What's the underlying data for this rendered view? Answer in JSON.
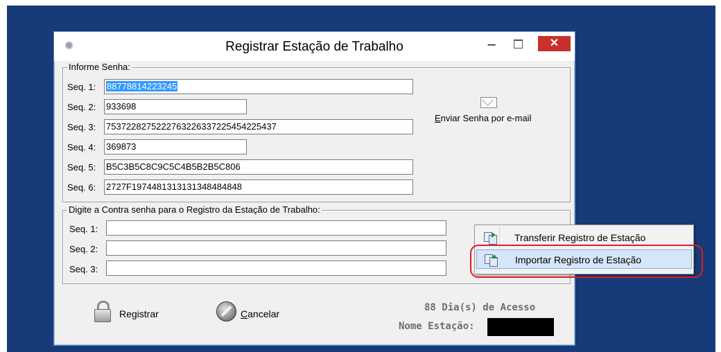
{
  "window": {
    "title": "Registrar Estação de Trabalho",
    "minimize_glyph": "–",
    "close_glyph": "✕"
  },
  "group_password": {
    "legend": "Informe Senha:",
    "rows": [
      {
        "label": "Seq. 1:",
        "value": "88778814223245"
      },
      {
        "label": "Seq. 2:",
        "value": "933698"
      },
      {
        "label": "Seq. 3:",
        "value": "753722827522276322633722545422543​7"
      },
      {
        "label": "Seq. 4:",
        "value": "369873"
      },
      {
        "label": "Seq. 5:",
        "value": "B5C3B5C8C9C5C4B5B2B5C806"
      },
      {
        "label": "Seq. 6:",
        "value": "2727F19744813131313484848​48"
      }
    ],
    "send_email": {
      "prefix": "E",
      "rest": "nviar Senha por e-mail"
    }
  },
  "group_counter": {
    "legend": "Digite a Contra senha para o Registro da Estação de Trabalho:",
    "rows": [
      {
        "label": "Seq. 1:",
        "value": ""
      },
      {
        "label": "Seq. 2:",
        "value": ""
      },
      {
        "label": "Seq. 3:",
        "value": ""
      }
    ]
  },
  "context_menu": {
    "items": [
      {
        "label": "Transferir Registro de Estação",
        "icon": "transfer-icon"
      },
      {
        "label": "Importar Registro de Estação",
        "icon": "import-icon"
      }
    ]
  },
  "footer": {
    "register_label": "Registrar",
    "cancel_prefix": "C",
    "cancel_rest": "ancelar",
    "access_days": "88 Dia(s) de Acesso",
    "station_label": "Nome Estação:"
  },
  "colors": {
    "desktop": "#163b78",
    "selection": "#3399ff",
    "close_button": "#c9302c",
    "annotation": "#e21b23",
    "menu_highlight": "#d5e6fa"
  }
}
